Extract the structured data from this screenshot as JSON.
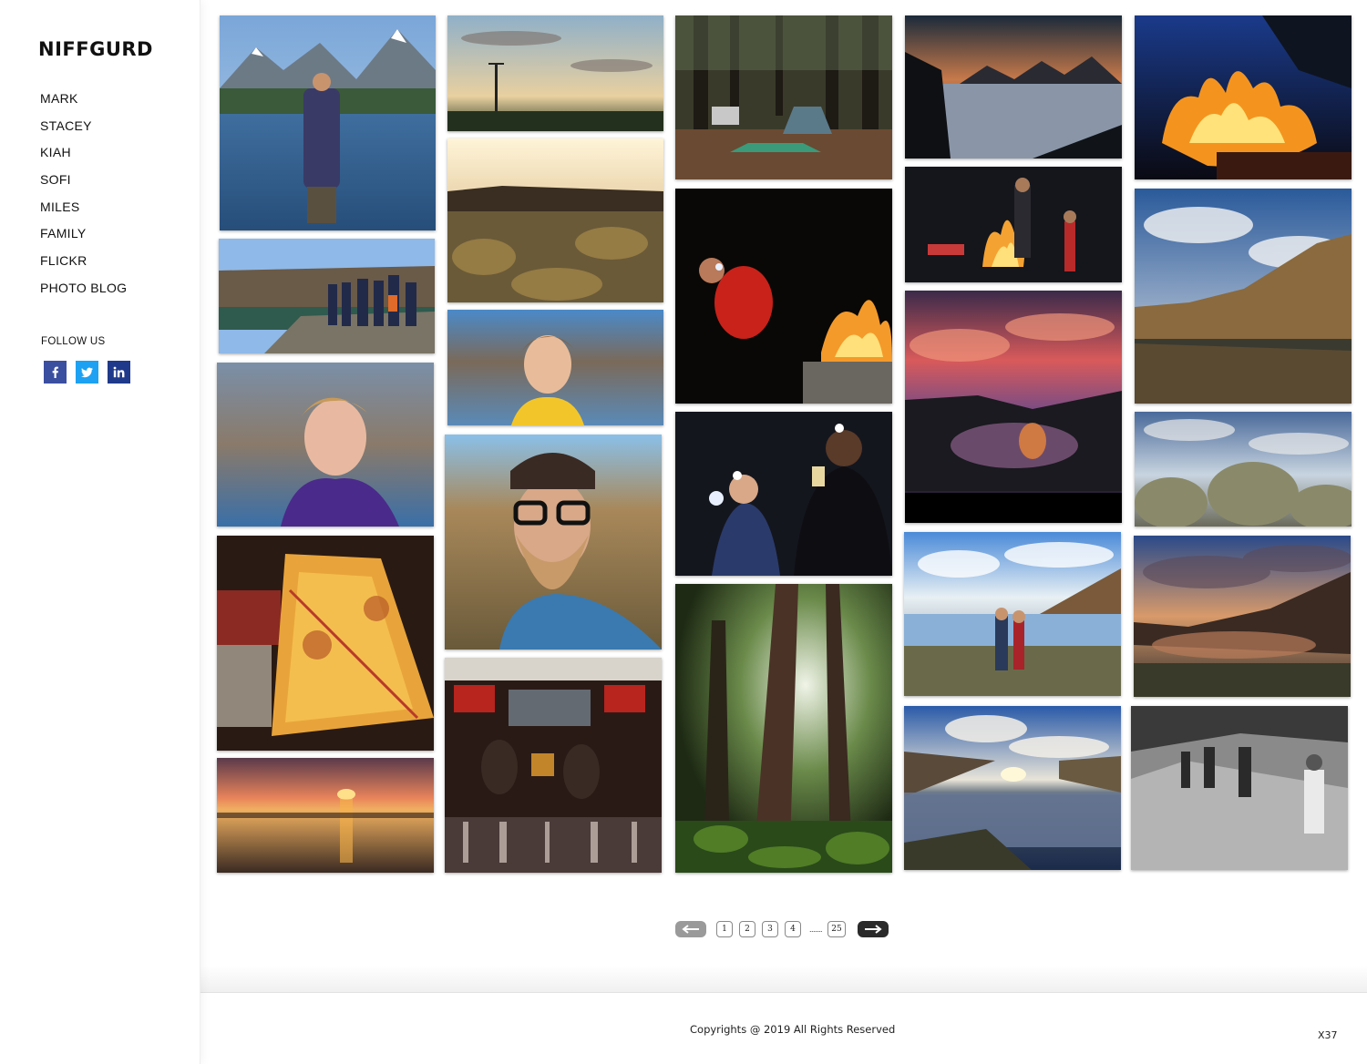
{
  "brand": {
    "logo": "NIFFGURD"
  },
  "nav": {
    "items": [
      {
        "label": "MARK"
      },
      {
        "label": "STACEY"
      },
      {
        "label": "KIAH"
      },
      {
        "label": "SOFI"
      },
      {
        "label": "MILES"
      },
      {
        "label": "FAMILY"
      },
      {
        "label": "FLICKR"
      },
      {
        "label": "PHOTO BLOG"
      }
    ]
  },
  "follow": {
    "label": "FOLLOW US",
    "networks": [
      {
        "icon": "facebook-icon",
        "glyph": "f",
        "color": "#3b4fa0"
      },
      {
        "icon": "twitter-icon",
        "glyph": "t",
        "color": "#1da1f2"
      },
      {
        "icon": "linkedin-icon",
        "glyph": "in",
        "color": "#1f3a8a"
      }
    ]
  },
  "gallery": {
    "photos": [
      {
        "name": "photo-man-at-mountain-lake",
        "subject": "man standing in mountain lake"
      },
      {
        "name": "photo-group-on-cliff",
        "subject": "group on canyon rim"
      },
      {
        "name": "photo-smiling-teen",
        "subject": "smiling teen portrait"
      },
      {
        "name": "photo-glowing-lamp",
        "subject": "glowing paper lamp"
      },
      {
        "name": "photo-beach-sunset",
        "subject": "sunset over tidal flats"
      },
      {
        "name": "photo-power-pole-sky",
        "subject": "power pole at dusk"
      },
      {
        "name": "photo-canyon-sunrise",
        "subject": "sunrise over canyon"
      },
      {
        "name": "photo-boy-portrait",
        "subject": "boy in yellow shirt"
      },
      {
        "name": "photo-bearded-man",
        "subject": "bearded man with glasses"
      },
      {
        "name": "photo-restaurant-booth",
        "subject": "couple in restaurant booth"
      },
      {
        "name": "photo-forest-campsite",
        "subject": "forest campsite with tent"
      },
      {
        "name": "photo-headlamp-campfire",
        "subject": "headlamp by campfire"
      },
      {
        "name": "photo-headlamps-night",
        "subject": "friends with headlamps"
      },
      {
        "name": "photo-tall-trees",
        "subject": "tall forest trees"
      },
      {
        "name": "photo-snowy-peaks-dusk",
        "subject": "snowy peaks at dusk"
      },
      {
        "name": "photo-campfire-people",
        "subject": "people around campfire"
      },
      {
        "name": "photo-pink-sunset-lake",
        "subject": "pink sunset over lake"
      },
      {
        "name": "photo-couple-at-lake",
        "subject": "couple at canyon lake"
      },
      {
        "name": "photo-canyon-reflection",
        "subject": "canyon lake reflection"
      },
      {
        "name": "photo-campfire-flames",
        "subject": "campfire flames"
      },
      {
        "name": "photo-canyon-cliffs",
        "subject": "canyon cliffs reflection"
      },
      {
        "name": "photo-sagebrush",
        "subject": "sagebrush field"
      },
      {
        "name": "photo-dramatic-clouds",
        "subject": "dramatic clouds over lake"
      },
      {
        "name": "photo-hikers-bw",
        "subject": "hikers black and white"
      }
    ]
  },
  "pagination": {
    "pages": [
      "1",
      "2",
      "3",
      "4"
    ],
    "ellipsis": ".......",
    "last": "25",
    "prev_icon": "arrow-left-icon",
    "next_icon": "arrow-right-icon"
  },
  "footer": {
    "copyright": "Copyrights @ 2019 All Rights Reserved",
    "badge": "X37"
  }
}
